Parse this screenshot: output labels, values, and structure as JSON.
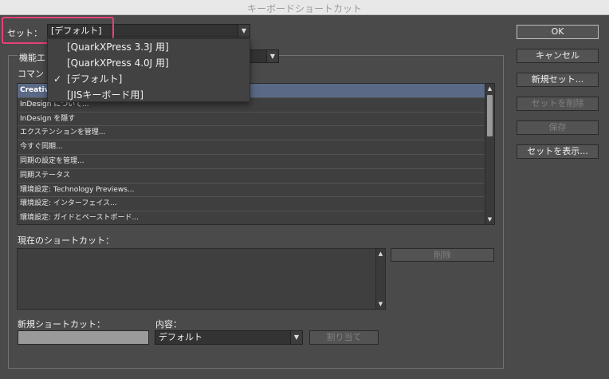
{
  "window": {
    "title": "キーボードショートカット"
  },
  "set": {
    "label": "セット：",
    "value": "[デフォルト]"
  },
  "dropdown": {
    "items": [
      {
        "label": "[QuarkXPress 3.3J 用]",
        "checked": false
      },
      {
        "label": "[QuarkXPress 4.0J 用]",
        "checked": false
      },
      {
        "label": "[デフォルト]",
        "checked": true
      },
      {
        "label": "[JISキーボード用]",
        "checked": false
      }
    ],
    "check_glyph": "✓"
  },
  "area": {
    "label_partial": "機能エ",
    "commands_label_partial": "コマン"
  },
  "commands": [
    "Creative",
    "InDesign について...",
    "InDesign を隠す",
    "エクステンションを管理...",
    "今すぐ同期...",
    "同期の設定を管理...",
    "同期ステータス",
    "環境設定: Technology Previews...",
    "環境設定: インターフェイス...",
    "環境設定: ガイドとペーストボード..."
  ],
  "current_shortcuts": {
    "label": "現在のショートカット："
  },
  "delete_button": "削除",
  "new_shortcut": {
    "label": "新規ショートカット：",
    "value": ""
  },
  "context": {
    "label": "内容：",
    "value": "デフォルト"
  },
  "assign_button": "割り当て",
  "buttons": {
    "ok": "OK",
    "cancel": "キャンセル",
    "new_set": "新規セット...",
    "delete_set": "セットを削除",
    "save": "保存",
    "show_set": "セットを表示..."
  },
  "colors": {
    "highlight_border": "#e8407b",
    "selected_row": "#5a6a86"
  },
  "icons": {
    "dropdown": "chevron-down-icon",
    "check": "check-icon"
  }
}
